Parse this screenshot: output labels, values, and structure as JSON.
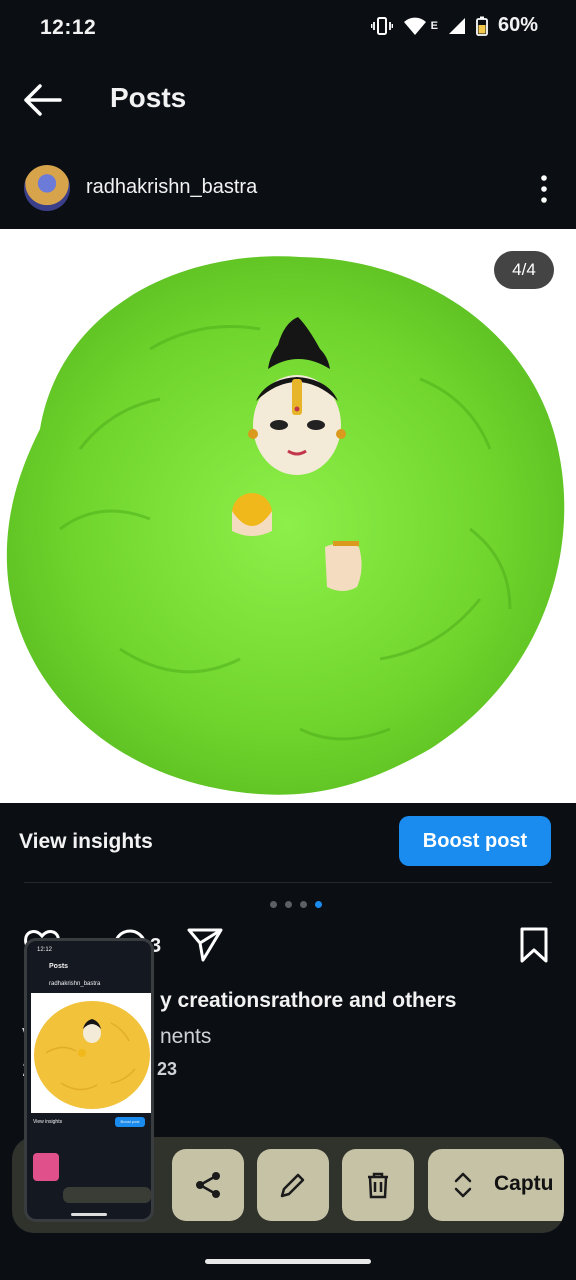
{
  "status_bar": {
    "time": "12:12",
    "network_type": "E",
    "battery": "60%"
  },
  "header": {
    "title": "Posts"
  },
  "post": {
    "username": "radhakrishn_bastra",
    "image_counter": "4/4",
    "image_count": 4,
    "active_image": 4,
    "comment_count": "3",
    "likes_text": "y creationsrathore and others",
    "comments_text": "nents",
    "comments_prefix": "V",
    "date_text": "23",
    "date_prefix": "2"
  },
  "insights": {
    "view_insights_label": "View insights",
    "boost_label": "Boost post"
  },
  "screenshot_toolbar": {
    "capture_label": "Captu"
  },
  "thumbnail": {
    "time": "12:12",
    "title": "Posts",
    "username": "radhakrishn_bastra",
    "view_insights_label": "View insights",
    "boost_label": "Boost post"
  },
  "colors": {
    "background": "#0b0f14",
    "accent": "#1a8cf0",
    "toolbar_button": "#c5c2a6",
    "fur_green": "#7fe23a",
    "thumb_fur_yellow": "#f1c23a"
  },
  "icons": {
    "back": "arrow-left-icon",
    "more": "vertical-dots-icon",
    "like": "heart-icon",
    "comment": "speech-bubble-icon",
    "share": "paper-plane-icon",
    "save": "bookmark-icon",
    "toolbar_share": "share-icon",
    "edit": "pencil-icon",
    "delete": "trash-icon",
    "capture": "expand-arrows-icon"
  }
}
